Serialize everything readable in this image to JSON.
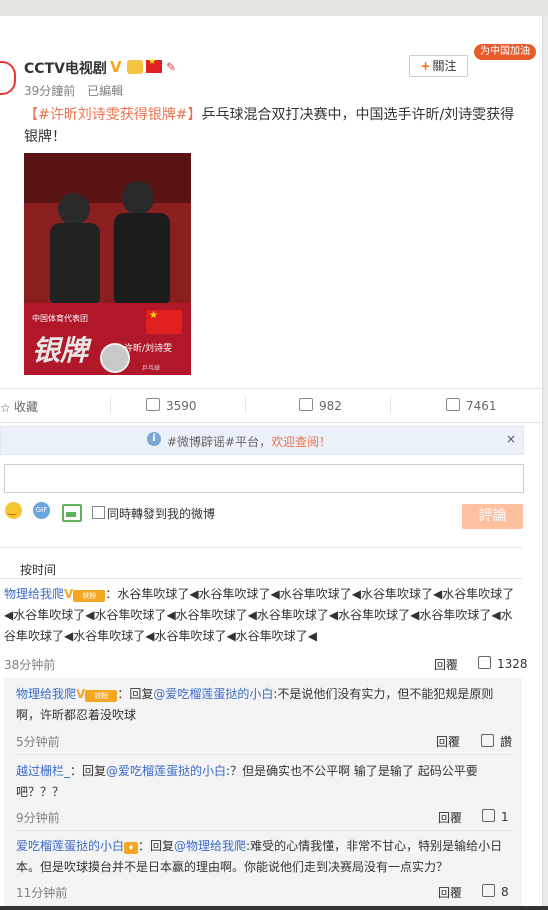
{
  "post": {
    "user_name": "CCTV电视剧",
    "time": "39分鐘前",
    "source": "已編輯",
    "follow_label": "關注",
    "cheer_label": "为中国加油",
    "topic": "【#许昕刘诗雯获得银牌#】",
    "text": "乒乓球混合双打决赛中，中国选手许昕/刘诗雯获得银牌！",
    "image": {
      "team_text": "中国体育代表团",
      "medal_text": "银牌",
      "names": "许昕/刘诗雯",
      "foot": "乒乓球"
    }
  },
  "actions": {
    "favorite": "收藏",
    "repost": "3590",
    "comment": "982",
    "like": "7461"
  },
  "notice": {
    "text": "#微博辟谣#平台，",
    "link": "欢迎查阅！",
    "close": "×"
  },
  "composer": {
    "checkbox_label": "同時轉發到我的微博",
    "submit_label": "評論"
  },
  "sort_label": "按时间",
  "comments": [
    {
      "name": "物理给我爬",
      "badge": "铁粉",
      "text": "：水谷隼吹球了◀水谷隼吹球了◀水谷隼吹球了◀水谷隼吹球了◀水谷隼吹球了◀水谷隼吹球了◀水谷隼吹球了◀水谷隼吹球了◀水谷隼吹球了◀水谷隼吹球了◀水谷隼吹球了◀水谷隼吹球了◀水谷隼吹球了◀水谷隼吹球了◀水谷隼吹球了◀",
      "time": "38分钟前",
      "reply": "回覆",
      "likes": "1328"
    },
    {
      "name": "物理给我爬",
      "badge": "铁粉",
      "prefix": "：回复",
      "mention": "@爱吃榴莲蛋挞的小白",
      "text": ":不是说他们没有实力，但不能犯规是原则啊，许昕都忍着没吹球",
      "time": "5分钟前",
      "reply": "回覆",
      "likes": "讚"
    },
    {
      "name": "越过栅栏_",
      "prefix": "：回复",
      "mention": "@爱吃榴莲蛋挞的小白",
      "text": ":？但是确实也不公平啊 输了是输了 起码公平要吧？？？",
      "time": "9分钟前",
      "reply": "回覆",
      "likes": "1"
    },
    {
      "name": "爱吃榴莲蛋挞的小白",
      "prefix": "：回复",
      "mention": "@物理给我爬",
      "text": ":难受的心情我懂，非常不甘心，特别是输给小日本。但是吹球摸台并不是日本赢的理由啊。你能说他们走到决赛局没有一点实力？",
      "time": "11分钟前",
      "reply": "回覆",
      "likes": "8"
    }
  ]
}
